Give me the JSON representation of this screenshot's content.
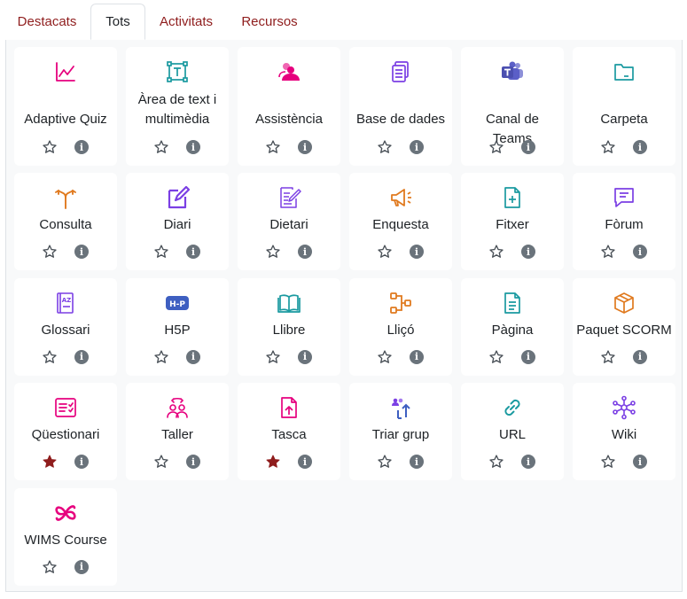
{
  "tabs": [
    {
      "label": "Destacats",
      "active": false
    },
    {
      "label": "Tots",
      "active": true
    },
    {
      "label": "Activitats",
      "active": false
    },
    {
      "label": "Recursos",
      "active": false
    }
  ],
  "colors": {
    "accent_link": "#8f1d1d",
    "starred": "#8f1d1d",
    "pink": "#e6007e",
    "teal": "#1a9aa0",
    "purple": "#7b3fe4",
    "orange": "#e07a1f",
    "blue": "#3e5fc1",
    "teams": "#5b5fc7"
  },
  "modules": [
    {
      "label": "Adaptive Quiz",
      "icon": "line-chart-icon",
      "starred": false
    },
    {
      "label": "Àrea de text i multimèdia",
      "icon": "text-area-icon",
      "starred": false
    },
    {
      "label": "Assistència",
      "icon": "attendance-icon",
      "starred": false
    },
    {
      "label": "Base de dades",
      "icon": "database-icon",
      "starred": false
    },
    {
      "label": "Canal de Teams",
      "icon": "teams-icon",
      "starred": false
    },
    {
      "label": "Carpeta",
      "icon": "folder-icon",
      "starred": false
    },
    {
      "label": "Consulta",
      "icon": "choice-icon",
      "starred": false
    },
    {
      "label": "Diari",
      "icon": "journal-icon",
      "starred": false
    },
    {
      "label": "Dietari",
      "icon": "diary-icon",
      "starred": false
    },
    {
      "label": "Enquesta",
      "icon": "megaphone-icon",
      "starred": false
    },
    {
      "label": "Fitxer",
      "icon": "file-icon",
      "starred": false
    },
    {
      "label": "Fòrum",
      "icon": "forum-icon",
      "starred": false
    },
    {
      "label": "Glossari",
      "icon": "glossary-icon",
      "starred": false
    },
    {
      "label": "H5P",
      "icon": "h5p-icon",
      "starred": false
    },
    {
      "label": "Llibre",
      "icon": "book-icon",
      "starred": false
    },
    {
      "label": "Lliçó",
      "icon": "lesson-icon",
      "starred": false
    },
    {
      "label": "Pàgina",
      "icon": "page-icon",
      "starred": false
    },
    {
      "label": "Paquet SCORM",
      "icon": "scorm-package-icon",
      "starred": false
    },
    {
      "label": "Qüestionari",
      "icon": "quiz-icon",
      "starred": true
    },
    {
      "label": "Taller",
      "icon": "workshop-icon",
      "starred": false
    },
    {
      "label": "Tasca",
      "icon": "assignment-icon",
      "starred": true
    },
    {
      "label": "Triar grup",
      "icon": "group-choice-icon",
      "starred": false
    },
    {
      "label": "URL",
      "icon": "link-icon",
      "starred": false
    },
    {
      "label": "Wiki",
      "icon": "wiki-icon",
      "starred": false
    },
    {
      "label": "WIMS Course",
      "icon": "wims-icon",
      "starred": false
    }
  ],
  "info_glyph": "i"
}
